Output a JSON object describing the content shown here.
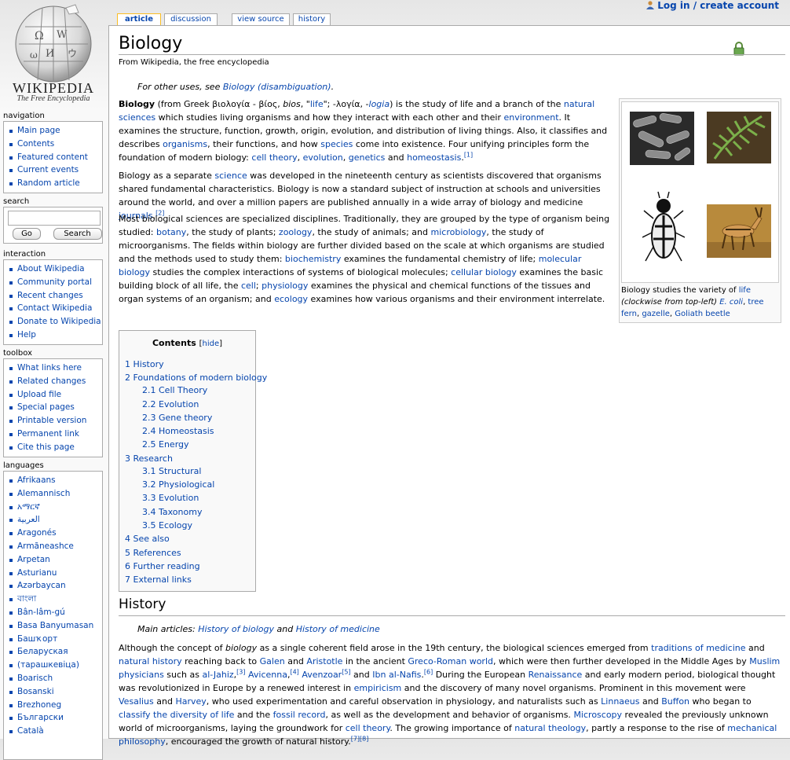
{
  "user_links": {
    "login": "Log in / create account"
  },
  "logo": {
    "wordmark": "WIKIPEDIA",
    "tagline": "The Free Encyclopedia"
  },
  "navigation": {
    "heading": "navigation",
    "items": [
      "Main page",
      "Contents",
      "Featured content",
      "Current events",
      "Random article"
    ]
  },
  "search": {
    "heading": "search",
    "value": "",
    "go_label": "Go",
    "search_label": "Search"
  },
  "interaction": {
    "heading": "interaction",
    "items": [
      "About Wikipedia",
      "Community portal",
      "Recent changes",
      "Contact Wikipedia",
      "Donate to Wikipedia",
      "Help"
    ]
  },
  "toolbox": {
    "heading": "toolbox",
    "items": [
      "What links here",
      "Related changes",
      "Upload file",
      "Special pages",
      "Printable version",
      "Permanent link",
      "Cite this page"
    ]
  },
  "languages": {
    "heading": "languages",
    "items": [
      "Afrikaans",
      "Alemannisch",
      "አማርኛ",
      "العربية",
      "Aragonés",
      "Armãneashce",
      "Arpetan",
      "Asturianu",
      "Azərbaycan",
      "বাংলা",
      "Bân-lâm-gú",
      "Basa Banyumasan",
      "Башҡорт",
      "Беларуская",
      "(тарашкевіца)",
      "Boarisch",
      "Bosanski",
      "Brezhoneg",
      "Български",
      "Català"
    ]
  },
  "tabs": [
    "article",
    "discussion",
    "view source",
    "history"
  ],
  "article": {
    "title": "Biology",
    "subtitle": "From Wikipedia, the free encyclopedia",
    "dablink": {
      "prefix": "For other uses, see ",
      "link": "Biology (disambiguation)",
      "suffix": "."
    },
    "p1": {
      "b": "Biology",
      "t1": " (from Greek βιολογία - βίος, ",
      "bios": "bios",
      "t2": ", \"",
      "life_link": "life",
      "t3": "\"; -λογία, -",
      "logia": "logia",
      "t4": ") is the study of life and a branch of the ",
      "natural_sciences": "natural sciences",
      "t5": " which studies living organisms and how they interact with each other and their ",
      "environment": "environment",
      "t6": ". It examines the structure, function, growth, origin, evolution, and distribution of living things. Also, it classifies and describes ",
      "organisms": "organisms",
      "t7": ", their functions, and how ",
      "species": "species",
      "t8": " come into existence. Four unifying principles form the foundation of modern biology: ",
      "cell_theory": "cell theory",
      "t9": ", ",
      "evolution": "evolution",
      "t10": ", ",
      "genetics": "genetics",
      "t11": " and ",
      "homeostasis": "homeostasis",
      "t12": ".",
      "ref": "[1]"
    },
    "p2": {
      "t1": "Biology as a separate ",
      "science": "science",
      "t2": " was developed in the nineteenth century as scientists discovered that organisms shared fundamental characteristics. Biology is now a standard subject of instruction at schools and universities around the world, and over a million papers are published annually in a wide array of biology and medicine ",
      "journals": "journals",
      "t3": ".",
      "ref": "[2]"
    },
    "p3": {
      "t1": "Most biological sciences are specialized disciplines. Traditionally, they are grouped by the type of organism being studied: ",
      "botany": "botany",
      "t2": ", the study of plants; ",
      "zoology": "zoology",
      "t3": ", the study of animals; and ",
      "microbiology": "microbiology",
      "t4": ", the study of microorganisms. The fields within biology are further divided based on the scale at which organisms are studied and the methods used to study them: ",
      "biochemistry": "biochemistry",
      "t5": " examines the fundamental chemistry of life; ",
      "molecular_biology": "molecular biology",
      "t6": " studies the complex interactions of systems of biological molecules; ",
      "cellular_biology": "cellular biology",
      "t7": " examines the basic building block of all life, the ",
      "cell": "cell",
      "t8": "; ",
      "physiology": "physiology",
      "t9": " examines the physical and chemical functions of the tissues and organ systems of an organism; and ",
      "ecology": "ecology",
      "t10": " examines how various organisms and their environment interrelate."
    },
    "thumb_caption": {
      "t1": "Biology studies the variety of ",
      "life": "life",
      "t2": " (clockwise from top-left) ",
      "ecoli": "E. coli",
      "t3": ", ",
      "tree_fern": "tree fern",
      "t4": ", ",
      "gazelle": "gazelle",
      "t5": ", ",
      "beetle": "Goliath beetle"
    },
    "toc": {
      "title": "Contents",
      "hide_open": "[",
      "hide": "hide",
      "hide_close": "]",
      "items": [
        {
          "num": "1",
          "text": "History",
          "level": 1
        },
        {
          "num": "2",
          "text": "Foundations of modern biology",
          "level": 1
        },
        {
          "num": "2.1",
          "text": "Cell Theory",
          "level": 2
        },
        {
          "num": "2.2",
          "text": "Evolution",
          "level": 2
        },
        {
          "num": "2.3",
          "text": "Gene theory",
          "level": 2
        },
        {
          "num": "2.4",
          "text": "Homeostasis",
          "level": 2
        },
        {
          "num": "2.5",
          "text": "Energy",
          "level": 2
        },
        {
          "num": "3",
          "text": "Research",
          "level": 1
        },
        {
          "num": "3.1",
          "text": "Structural",
          "level": 2
        },
        {
          "num": "3.2",
          "text": "Physiological",
          "level": 2
        },
        {
          "num": "3.3",
          "text": "Evolution",
          "level": 2
        },
        {
          "num": "3.4",
          "text": "Taxonomy",
          "level": 2
        },
        {
          "num": "3.5",
          "text": "Ecology",
          "level": 2
        },
        {
          "num": "4",
          "text": "See also",
          "level": 1
        },
        {
          "num": "5",
          "text": "References",
          "level": 1
        },
        {
          "num": "6",
          "text": "Further reading",
          "level": 1
        },
        {
          "num": "7",
          "text": "External links",
          "level": 1
        }
      ]
    },
    "history": {
      "heading": "History",
      "main_prefix": "Main articles: ",
      "main_link1": "History of biology",
      "main_and": " and ",
      "main_link2": "History of medicine",
      "p": {
        "t1": "Although the concept of ",
        "biology_i": "biology",
        "t2": " as a single coherent field arose in the 19th century, the biological sciences emerged from ",
        "traditions": "traditions of medicine",
        "t3": " and ",
        "natural_history": "natural history",
        "t4": " reaching back to ",
        "galen": "Galen",
        "t5": " and ",
        "aristotle": "Aristotle",
        "t6": " in the ancient ",
        "greco": "Greco-Roman world",
        "t7": ", which were then further developed in the Middle Ages by ",
        "muslim": "Muslim physicians",
        "t8": " such as ",
        "jahiz": "al-Jahiz",
        "t9": ",",
        "ref3": "[3]",
        "avicenna": "Avicenna",
        "t10": ",",
        "ref4": "[4]",
        "avenzoar": "Avenzoar",
        "ref5": "[5]",
        "t11": " and ",
        "nafis": "Ibn al-Nafis",
        "t12": ".",
        "ref6": "[6]",
        "t13": " During the European ",
        "renaissance": "Renaissance",
        "t14": " and early modern period, biological thought was revolutionized in Europe by a renewed interest in ",
        "empiricism": "empiricism",
        "t15": " and the discovery of many novel organisms. Prominent in this movement were ",
        "vesalius": "Vesalius",
        "t16": " and ",
        "harvey": "Harvey",
        "t17": ", who used experimentation and careful observation in physiology, and naturalists such as ",
        "linnaeus": "Linnaeus",
        "t18": " and ",
        "buffon": "Buffon",
        "t19": " who began to ",
        "classify": "classify the diversity of life",
        "t20": " and the ",
        "fossil": "fossil record",
        "t21": ", as well as the development and behavior of organisms. ",
        "microscopy": "Microscopy",
        "t22": " revealed the previously unknown world of microorganisms, laying the groundwork for ",
        "cell_theory": "cell theory",
        "t23": ". The growing importance of ",
        "nat_theology": "natural theology",
        "t24": ", partly a response to the rise of ",
        "mech_phil": "mechanical philosophy",
        "t25": ", encouraged the growth of natural history.",
        "ref78": "[7][8]"
      }
    }
  },
  "colors": {
    "link": "#0645ad",
    "tab_selected_border": "#fabd23"
  }
}
